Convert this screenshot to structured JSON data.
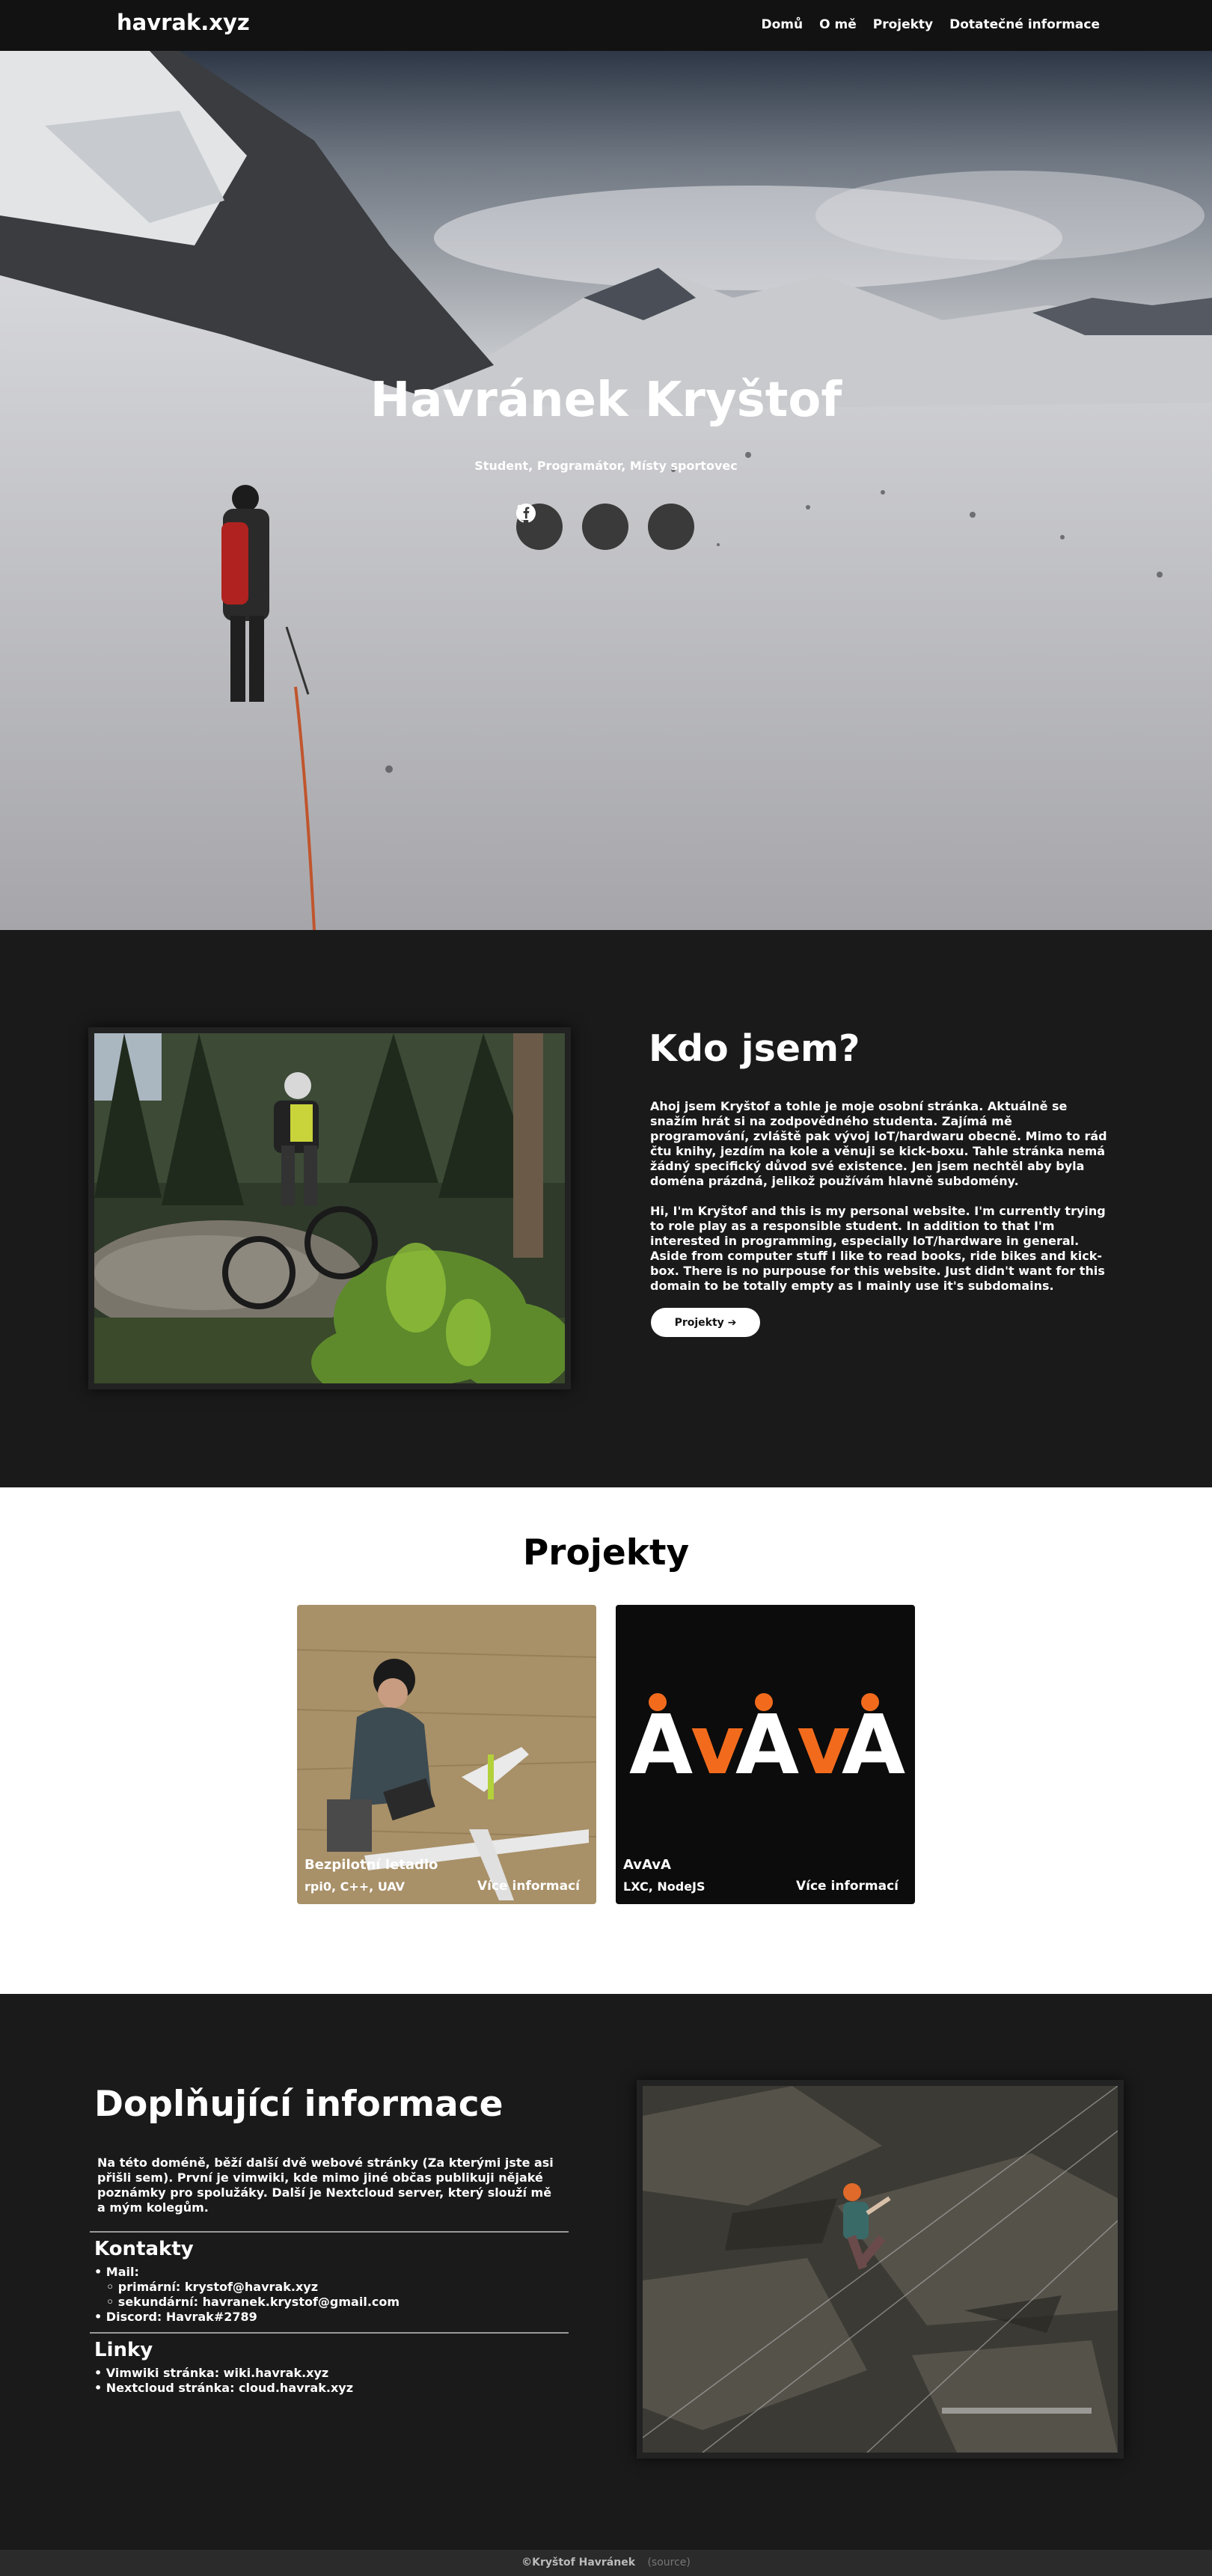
{
  "nav": {
    "brand": "havrak.xyz",
    "links": [
      "Domů",
      "O mě",
      "Projekty",
      "Dotatečné informace"
    ]
  },
  "hero": {
    "title": "Havránek Kryštof",
    "subtitle": "Student, Programátor, Místy sportovec",
    "socials": [
      "github-icon",
      "instagram-icon",
      "facebook-icon"
    ]
  },
  "about": {
    "heading": "Kdo jsem?",
    "paragraph_cz": "Ahoj jsem Kryštof a tohle je moje osobní stránka. Aktuálně se snažím hrát si na zodpovědného studenta. Zajímá mě programování, zvláště pak vývoj IoT/hardwaru obecně. Mimo to rád čtu knihy, jezdím na kole a věnuji se kick-boxu. Tahle stránka nemá žádný specifický důvod své existence. Jen jsem nechtěl aby byla doména prázdná, jelikož používám hlavně subdomény.",
    "paragraph_en": "Hi, I'm Kryštof and this is my personal website. I'm currently trying to role play as a responsible student. In addition to that I'm interested in programming, especially IoT/hardware in general. Aside from computer stuff I like to read books, ride bikes and kick-box. There is no purpouse for this website. Just didn't want for this domain to be totally empty as I mainly use it's subdomains.",
    "button": "Projekty ➔"
  },
  "projects": {
    "heading": "Projekty",
    "cards": [
      {
        "title": "Bezpilotní letadlo",
        "stack": "rpi0, C++, UAV",
        "more": "Více informací"
      },
      {
        "title": "AvAvA",
        "stack": "LXC, NodeJS",
        "more": "Více informací",
        "logo": "ÅvÅvÅ"
      }
    ]
  },
  "info": {
    "heading": "Doplňující informace",
    "paragraph": "Na této doméně, běží další dvě webové stránky (Za kterými jste asi přišli sem). První je vimwiki, kde mimo jiné občas publikuji nějaké poznámky pro spolužáky. Další je Nextcloud server, který slouží mě a mým kolegům.",
    "contacts_heading": "Kontakty",
    "contacts": {
      "mail": "• Mail:",
      "primary": "◦ primární: krystof@havrak.xyz",
      "secondary": "◦ sekundární: havranek.krystof@gmail.com",
      "discord": "• Discord: Havrak#2789"
    },
    "links_heading": "Linky",
    "links": [
      "• Vimwiki stránka: wiki.havrak.xyz",
      "• Nextcloud stránka: cloud.havrak.xyz"
    ]
  },
  "footer": {
    "copy": "©Kryštof Havránek",
    "source": "(source)"
  },
  "colors": {
    "dark": "#1a1a1a",
    "nav": "#121212",
    "accent_orange": "#f26b1d"
  }
}
